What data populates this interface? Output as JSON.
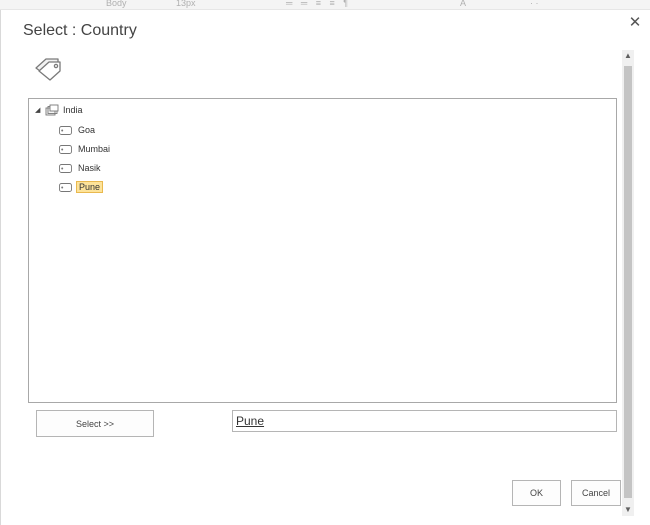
{
  "background_ribbon": {
    "items": [
      "Body",
      "13px",
      "═ ═ ≡ ≡ ¶",
      "A",
      "· ·"
    ]
  },
  "dialog": {
    "title": "Select : Country",
    "close_icon": "✕",
    "header_icon": "tags-icon"
  },
  "tree": {
    "expander": "◢",
    "root": {
      "label": "India",
      "icon": "term-set-icon"
    },
    "children": [
      {
        "label": "Goa",
        "icon": "tag-icon",
        "selected": false
      },
      {
        "label": "Mumbai",
        "icon": "tag-icon",
        "selected": false
      },
      {
        "label": "Nasik",
        "icon": "tag-icon",
        "selected": false
      },
      {
        "label": "Pune",
        "icon": "tag-icon",
        "selected": true
      }
    ]
  },
  "selection": {
    "select_label": "Select >>",
    "value": "Pune"
  },
  "footer": {
    "ok_label": "OK",
    "cancel_label": "Cancel"
  },
  "scrollbar": {
    "up": "▲",
    "down": "▼"
  },
  "colors": {
    "selected_bg": "#fde39a",
    "selected_border": "#e9b94f",
    "panel_border": "#a8a8a8"
  }
}
